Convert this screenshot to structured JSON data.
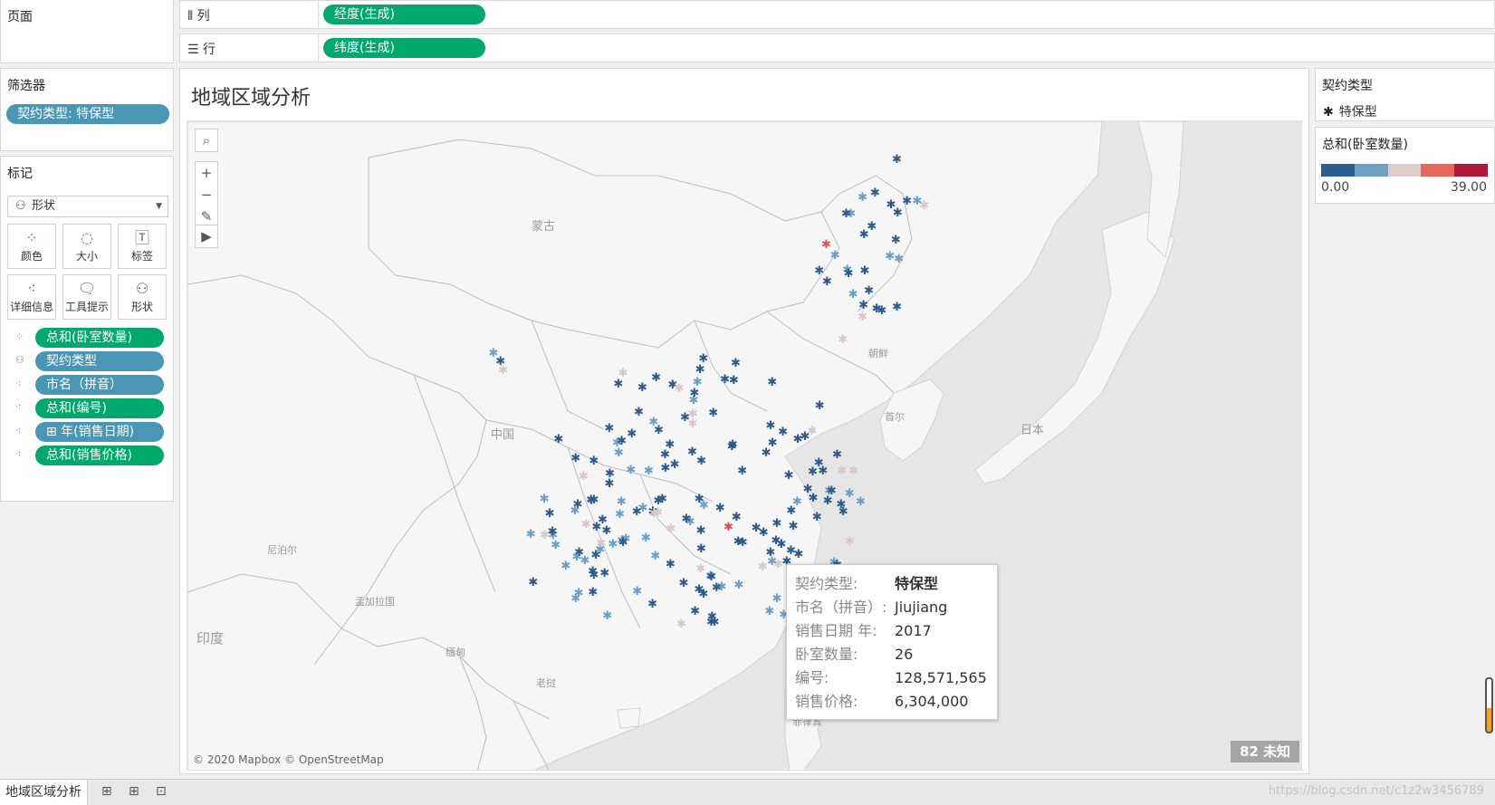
{
  "panes": {
    "pages": "页面",
    "filters": "筛选器",
    "marks": "标记"
  },
  "filter_pill": "契约类型: 特保型",
  "mark_type": "形状",
  "mark_buttons": [
    "颜色",
    "大小",
    "标签",
    "详细信息",
    "工具提示",
    "形状"
  ],
  "mark_fields": [
    {
      "label": "总和(卧室数量)",
      "icon": "color-dots-icon",
      "color": "#00a86b"
    },
    {
      "label": "契约类型",
      "icon": "shape-icon",
      "color": "#4a96b5"
    },
    {
      "label": "市名（拼音）",
      "icon": "detail-icon",
      "color": "#4a96b5"
    },
    {
      "label": "总和(编号)",
      "icon": "detail-icon",
      "color": "#00a86b"
    },
    {
      "label": "⊞ 年(销售日期)",
      "icon": "detail-icon",
      "color": "#4a96b5"
    },
    {
      "label": "总和(销售价格)",
      "icon": "detail-icon",
      "color": "#00a86b"
    }
  ],
  "shelves": {
    "columns_label": "列",
    "columns_pill": "经度(生成)",
    "rows_label": "行",
    "rows_pill": "纬度(生成)"
  },
  "sheet_title": "地域区域分析",
  "map": {
    "labels": {
      "mongolia": "蒙古",
      "china": "中国",
      "japan": "日本",
      "korea": "朝鲜",
      "seoul": "首尔",
      "nepal": "尼泊尔",
      "bangladesh": "孟加拉国",
      "india": "印度",
      "myanmar": "缅甸",
      "laos": "老挝",
      "philippines": "菲律宾"
    },
    "attribution": "© 2020 Mapbox © OpenStreetMap",
    "unknown_badge": "82 未知",
    "dark_color": "#2e5b8a",
    "mid_color": "#6a9fc7",
    "light_color": "#d9c6c6",
    "red_color": "#e05050"
  },
  "tooltip": {
    "rows": [
      {
        "key": "契约类型:",
        "value": "特保型"
      },
      {
        "key": "市名（拼音）:",
        "value": "Jiujiang"
      },
      {
        "key": "销售日期 年:",
        "value": "2017"
      },
      {
        "key": "卧室数量:",
        "value": "26"
      },
      {
        "key": "编号:",
        "value": "128,571,565"
      },
      {
        "key": "销售价格:",
        "value": "6,304,000"
      }
    ]
  },
  "legend_shape": {
    "title": "契约类型",
    "item": "特保型"
  },
  "legend_color": {
    "title": "总和(卧室数量)",
    "min": "0.00",
    "max": "39.00",
    "ramp": [
      "#2a5f8f",
      "#6f9fc6",
      "#dccccc",
      "#e8675a",
      "#b01a38"
    ]
  },
  "tabs": {
    "sheet": "地域区域分析"
  },
  "watermark": "https://blog.csdn.net/c1z2w3456789"
}
